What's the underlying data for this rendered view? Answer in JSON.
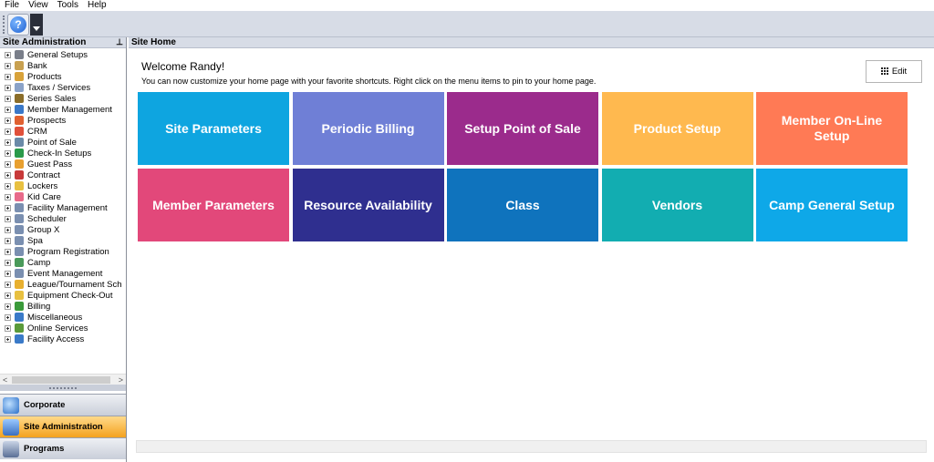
{
  "menu": [
    "File",
    "View",
    "Tools",
    "Help"
  ],
  "toolbar": {
    "help_icon": "help-icon",
    "dropdown_icon": "dropdown-arrow-icon"
  },
  "sidebar": {
    "title": "Site Administration",
    "pin_glyph": "ᵖ",
    "items": [
      {
        "label": "General Setups",
        "color": "#7a7f8a"
      },
      {
        "label": "Bank",
        "color": "#c8a050"
      },
      {
        "label": "Products",
        "color": "#d8a23a"
      },
      {
        "label": "Taxes / Services",
        "color": "#8aa2c8"
      },
      {
        "label": "Series Sales",
        "color": "#8a6d2a"
      },
      {
        "label": "Member Management",
        "color": "#3a78c8"
      },
      {
        "label": "Prospects",
        "color": "#e06030"
      },
      {
        "label": "CRM",
        "color": "#e0503a"
      },
      {
        "label": "Point of Sale",
        "color": "#6a8aa8"
      },
      {
        "label": "Check-In Setups",
        "color": "#2a9a4a"
      },
      {
        "label": "Guest Pass",
        "color": "#e8a030"
      },
      {
        "label": "Contract",
        "color": "#c83a3a"
      },
      {
        "label": "Lockers",
        "color": "#e8c040"
      },
      {
        "label": "Kid Care",
        "color": "#e86a8a"
      },
      {
        "label": "Facility Management",
        "color": "#7a8fb0"
      },
      {
        "label": "Scheduler",
        "color": "#7a8fb0"
      },
      {
        "label": "Group X",
        "color": "#7a8fb0"
      },
      {
        "label": "Spa",
        "color": "#7a8fb0"
      },
      {
        "label": "Program Registration",
        "color": "#7a8fb0"
      },
      {
        "label": "Camp",
        "color": "#4a9a5a"
      },
      {
        "label": "Event Management",
        "color": "#7a8fb0"
      },
      {
        "label": "League/Tournament Sch",
        "color": "#e8b030"
      },
      {
        "label": "Equipment Check-Out",
        "color": "#e8c040"
      },
      {
        "label": "Billing",
        "color": "#3a9a3a"
      },
      {
        "label": "Miscellaneous",
        "color": "#3a7ac8"
      },
      {
        "label": "Online Services",
        "color": "#5a9a3a"
      },
      {
        "label": "Facility Access",
        "color": "#3a7ac8"
      }
    ],
    "scroll_left": "<",
    "scroll_right": ">",
    "nav": [
      {
        "label": "Corporate",
        "active": false
      },
      {
        "label": "Site Administration",
        "active": true
      },
      {
        "label": "Programs",
        "active": false
      }
    ]
  },
  "main": {
    "header": "Site Home",
    "welcome": "Welcome Randy!",
    "subtitle": "You can now customize your home page with your favorite shortcuts.  Right click on the menu items to pin to your home page.",
    "edit_label": "Edit",
    "tiles": [
      {
        "label": "Site Parameters",
        "color": "#0ea5e0"
      },
      {
        "label": "Periodic Billing",
        "color": "#6f7fd6"
      },
      {
        "label": "Setup Point of Sale",
        "color": "#9b2b8c"
      },
      {
        "label": "Product Setup",
        "color": "#ffb94f"
      },
      {
        "label": "Member On-Line Setup",
        "color": "#ff7a55"
      },
      {
        "label": "Member Parameters",
        "color": "#e2487a"
      },
      {
        "label": "Resource Availability",
        "color": "#2f2f8f"
      },
      {
        "label": "Class",
        "color": "#0f73bd"
      },
      {
        "label": "Vendors",
        "color": "#12adb1"
      },
      {
        "label": "Camp General Setup",
        "color": "#0ea8e8"
      }
    ]
  }
}
